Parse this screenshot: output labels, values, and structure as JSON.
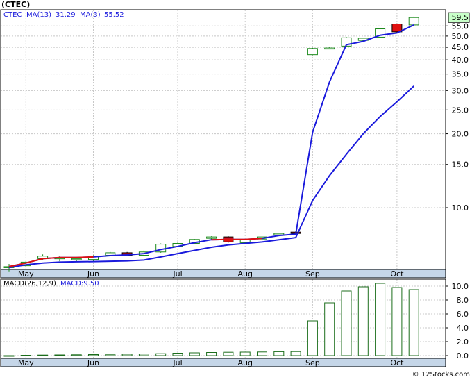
{
  "header": {
    "ticker": "(CTEC)",
    "price_symbol": "CTEC",
    "ma13_label": "MA(13)",
    "ma13_value": "31.29",
    "ma3_label": "MA(3)",
    "ma3_value": "55.52"
  },
  "last_price_label": "59.5",
  "source": "© 12Stocks.com",
  "colors": {
    "ma_line": "#1a1adc",
    "down_candle": "#e01010",
    "up_candle_border": "#1c8a1c",
    "short_ma_segment": "#e01010",
    "grid": "#c8c8c8",
    "axis_band": "#c5d6e8",
    "macd_bar_border": "#1c6e1c",
    "last_price_box": "#c8ffc8"
  },
  "chart_data": [
    {
      "type": "candlestick",
      "title": "(CTEC)",
      "y_scale": "log",
      "ylim": [
        5.6,
        64.0
      ],
      "y_ticks": [
        10.0,
        15.0,
        20.0,
        25.0,
        30.0,
        35.0,
        40.0,
        45.0,
        50.0,
        55.0
      ],
      "x_labels": [
        {
          "label": "May",
          "index": 1
        },
        {
          "label": "Jun",
          "index": 5
        },
        {
          "label": "Jul",
          "index": 10
        },
        {
          "label": "Aug",
          "index": 14
        },
        {
          "label": "Sep",
          "index": 18
        },
        {
          "label": "Oct",
          "index": 23
        }
      ],
      "candles": [
        {
          "o": 5.7,
          "h": 5.9,
          "l": 5.5,
          "c": 5.75,
          "dir": "up"
        },
        {
          "o": 5.8,
          "h": 6.05,
          "l": 5.75,
          "c": 6.0,
          "dir": "up"
        },
        {
          "o": 6.2,
          "h": 6.45,
          "l": 6.1,
          "c": 6.35,
          "dir": "up"
        },
        {
          "o": 6.2,
          "h": 6.35,
          "l": 6.05,
          "c": 6.25,
          "dir": "up"
        },
        {
          "o": 6.15,
          "h": 6.3,
          "l": 6.05,
          "c": 6.2,
          "dir": "up"
        },
        {
          "o": 6.15,
          "h": 6.4,
          "l": 6.05,
          "c": 6.35,
          "dir": "up"
        },
        {
          "o": 6.4,
          "h": 6.6,
          "l": 6.35,
          "c": 6.55,
          "dir": "up"
        },
        {
          "o": 6.55,
          "h": 6.6,
          "l": 6.35,
          "c": 6.38,
          "dir": "down"
        },
        {
          "o": 6.4,
          "h": 6.7,
          "l": 6.35,
          "c": 6.6,
          "dir": "up"
        },
        {
          "o": 6.6,
          "h": 7.15,
          "l": 6.55,
          "c": 7.1,
          "dir": "up"
        },
        {
          "o": 6.95,
          "h": 7.2,
          "l": 6.9,
          "c": 7.15,
          "dir": "up"
        },
        {
          "o": 7.15,
          "h": 7.45,
          "l": 7.1,
          "c": 7.42,
          "dir": "up"
        },
        {
          "o": 7.5,
          "h": 7.65,
          "l": 7.4,
          "c": 7.6,
          "dir": "up"
        },
        {
          "o": 7.6,
          "h": 7.65,
          "l": 7.2,
          "c": 7.25,
          "dir": "down"
        },
        {
          "o": 7.2,
          "h": 7.45,
          "l": 7.15,
          "c": 7.4,
          "dir": "up"
        },
        {
          "o": 7.45,
          "h": 7.65,
          "l": 7.4,
          "c": 7.6,
          "dir": "up"
        },
        {
          "o": 7.75,
          "h": 7.9,
          "l": 7.7,
          "c": 7.85,
          "dir": "up"
        },
        {
          "o": 7.95,
          "h": 8.05,
          "l": 7.8,
          "c": 7.85,
          "dir": "down"
        },
        {
          "o": 42.0,
          "h": 44.8,
          "l": 41.8,
          "c": 44.5,
          "dir": "up"
        },
        {
          "o": 44.6,
          "h": 45.0,
          "l": 44.2,
          "c": 44.7,
          "dir": "up"
        },
        {
          "o": 45.5,
          "h": 49.6,
          "l": 45.3,
          "c": 49.2,
          "dir": "up"
        },
        {
          "o": 48.0,
          "h": 49.3,
          "l": 47.8,
          "c": 49.0,
          "dir": "up"
        },
        {
          "o": 49.5,
          "h": 53.8,
          "l": 49.3,
          "c": 53.5,
          "dir": "up"
        },
        {
          "o": 56.0,
          "h": 56.3,
          "l": 51.5,
          "c": 52.0,
          "dir": "down"
        },
        {
          "o": 55.5,
          "h": 60.0,
          "l": 55.3,
          "c": 59.5,
          "dir": "up"
        }
      ],
      "series": [
        {
          "name": "MA(3)",
          "values": [
            5.75,
            5.95,
            6.2,
            6.27,
            6.27,
            6.3,
            6.38,
            6.42,
            6.5,
            6.75,
            6.95,
            7.2,
            7.4,
            7.42,
            7.42,
            7.5,
            7.7,
            7.8,
            20.3,
            32.5,
            46.1,
            47.6,
            50.4,
            51.5,
            55.5
          ]
        },
        {
          "name": "MA(13)",
          "values": [
            5.7,
            5.85,
            5.95,
            6.0,
            6.02,
            6.03,
            6.05,
            6.07,
            6.12,
            6.3,
            6.5,
            6.7,
            6.9,
            7.05,
            7.15,
            7.25,
            7.4,
            7.55,
            10.7,
            13.5,
            16.5,
            20.0,
            23.5,
            27.0,
            31.29
          ]
        }
      ],
      "short_segments": [
        {
          "from": 0,
          "to": 5
        },
        {
          "from": 12,
          "to": 15
        }
      ]
    },
    {
      "type": "bar",
      "title": "MACD(26,12,9)",
      "value_label": "MACD:9.50",
      "ylim": [
        -0.4,
        11.0
      ],
      "y_ticks": [
        0.0,
        2.0,
        4.0,
        6.0,
        8.0,
        10.0
      ],
      "x_labels": [
        {
          "label": "May",
          "index": 1
        },
        {
          "label": "Jun",
          "index": 5
        },
        {
          "label": "Jul",
          "index": 10
        },
        {
          "label": "Aug",
          "index": 14
        },
        {
          "label": "Sep",
          "index": 18
        },
        {
          "label": "Oct",
          "index": 23
        }
      ],
      "values": [
        0.0,
        0.05,
        0.08,
        0.1,
        0.12,
        0.15,
        0.18,
        0.2,
        0.22,
        0.28,
        0.35,
        0.4,
        0.45,
        0.48,
        0.5,
        0.52,
        0.56,
        0.58,
        5.0,
        7.6,
        9.3,
        9.9,
        10.4,
        9.8,
        9.5
      ]
    }
  ]
}
